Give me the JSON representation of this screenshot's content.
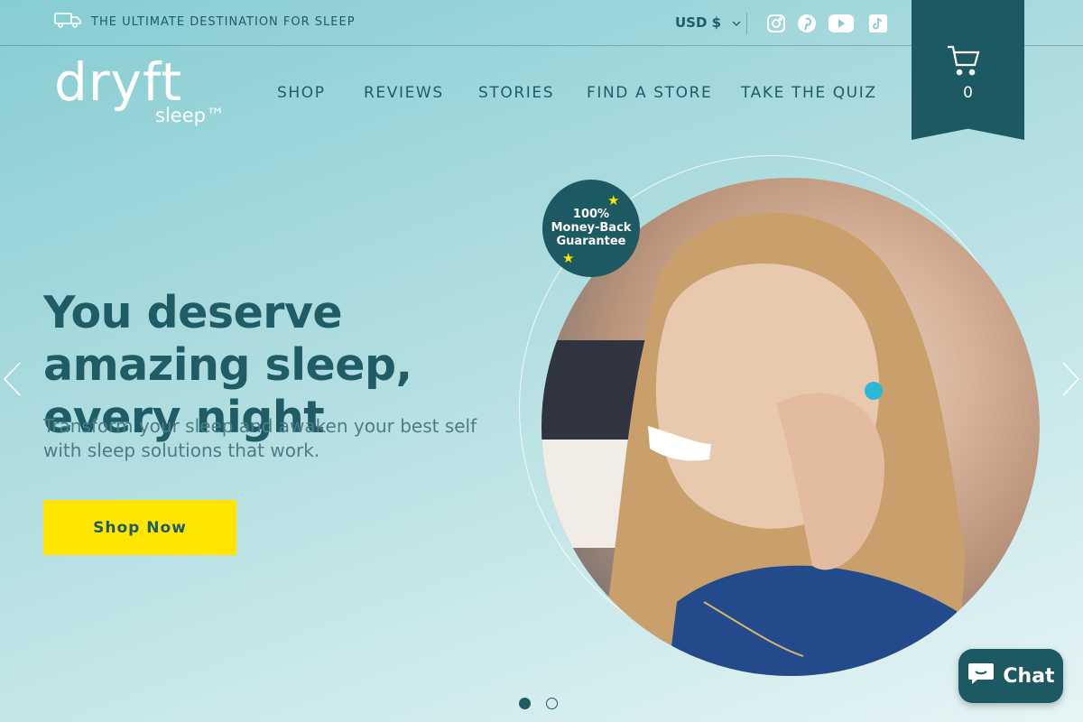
{
  "announcement": {
    "text": "THE ULTIMATE DESTINATION FOR SLEEP",
    "icon": "truck-icon"
  },
  "currency": {
    "label": "USD $"
  },
  "social": [
    {
      "name": "instagram-icon"
    },
    {
      "name": "pinterest-icon"
    },
    {
      "name": "youtube-icon"
    },
    {
      "name": "tiktok-icon"
    }
  ],
  "cart": {
    "count": "0",
    "icon": "cart-icon"
  },
  "logo": {
    "word": "dryft",
    "sub": "sleep™"
  },
  "nav": [
    {
      "label": "SHOP"
    },
    {
      "label": "REVIEWS"
    },
    {
      "label": "STORIES"
    },
    {
      "label": "FIND A STORE"
    },
    {
      "label": "TAKE THE QUIZ"
    }
  ],
  "hero": {
    "title": "You deserve amazing sleep, every night",
    "subtitle": "Transform your sleep and awaken your best self with sleep solutions that work.",
    "cta": "Shop Now"
  },
  "badge": {
    "line1": "100%",
    "line2": "Money-Back",
    "line3": "Guarantee"
  },
  "slider": {
    "total": 2,
    "active": 1
  },
  "chat": {
    "label": "Chat"
  },
  "colors": {
    "primary": "#1d5962",
    "accent": "#ffe500",
    "text": "#1f5c66"
  }
}
